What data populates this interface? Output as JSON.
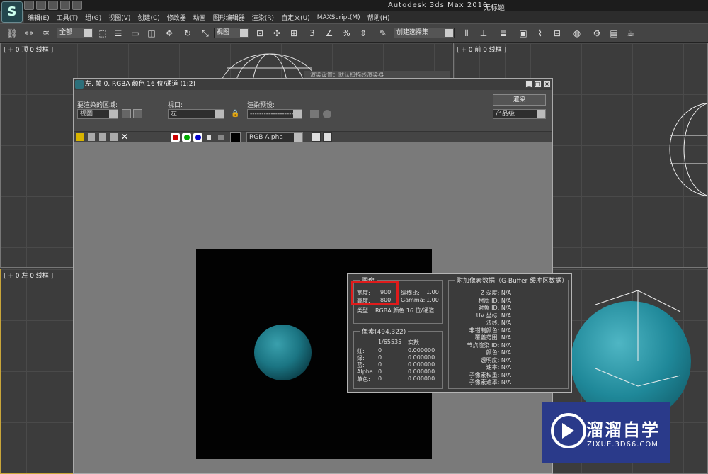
{
  "app": {
    "title": "Autodesk 3ds Max  2010",
    "doc": "无标题"
  },
  "menu": [
    "编辑(E)",
    "工具(T)",
    "组(G)",
    "视图(V)",
    "创建(C)",
    "修改器",
    "动画",
    "图形编辑器",
    "渲染(R)",
    "自定义(U)",
    "MAXScript(M)",
    "帮助(H)"
  ],
  "toolbar": {
    "filter": "全部",
    "refcoord": "视图",
    "selset": "创建选择集",
    "snap3": "3"
  },
  "viewports": {
    "top": "[ + 0 顶 0 线框 ]",
    "front": "[ + 0 前 0 线框 ]",
    "left": "[ + 0 左 0 线框 ]"
  },
  "render_window": {
    "title": "左, 帧 0, RGBA 颜色 16 位/通道 (1:2)",
    "area_label": "要渲染的区域:",
    "area_value": "视图",
    "viewport_label": "视口:",
    "viewport_value": "左",
    "preset_label": "渲染预设:",
    "preset_value": "-------------------",
    "render_button": "渲染",
    "quality": "产品级",
    "channel": "RGB Alpha",
    "behind_title": "渲染设置：默认扫描线渲染器"
  },
  "image_info": {
    "group_title": "图像",
    "width_label": "宽度:",
    "width": "900",
    "height_label": "高度:",
    "height": "800",
    "aspect_label": "纵横比:",
    "aspect": "1.00",
    "gamma_label": "Gamma:",
    "gamma": "1.00",
    "type_label": "类型:",
    "type": "RGBA 颜色 16 位/通道",
    "pixel_title": "像素(494,322)",
    "pixel_head1": "1/65535",
    "pixel_head2": "实数",
    "pixel_rows": [
      {
        "name": "红:",
        "v1": "0",
        "v2": "0.000000"
      },
      {
        "name": "绿:",
        "v1": "0",
        "v2": "0.000000"
      },
      {
        "name": "蓝:",
        "v1": "0",
        "v2": "0.000000"
      },
      {
        "name": "Alpha:",
        "v1": "0",
        "v2": "0.000000"
      },
      {
        "name": "单色:",
        "v1": "0",
        "v2": "0.000000"
      }
    ],
    "gbuffer_title": "附加像素数据（G-Buffer 缓冲区数据）",
    "gbuffer_rows": [
      "Z 深度: N/A",
      "材质 ID: N/A",
      "对象 ID: N/A",
      "UV 坐标: N/A",
      "法线: N/A",
      "非钳制颜色: N/A",
      "覆盖范围: N/A",
      "节点渲染 ID: N/A",
      "颜色: N/A",
      "透明度: N/A",
      "速率: N/A",
      "子像素权重: N/A",
      "子像素遮罩: N/A"
    ]
  },
  "watermark": {
    "title": "溜溜自学",
    "url": "ZIXUE.3D66.COM"
  }
}
